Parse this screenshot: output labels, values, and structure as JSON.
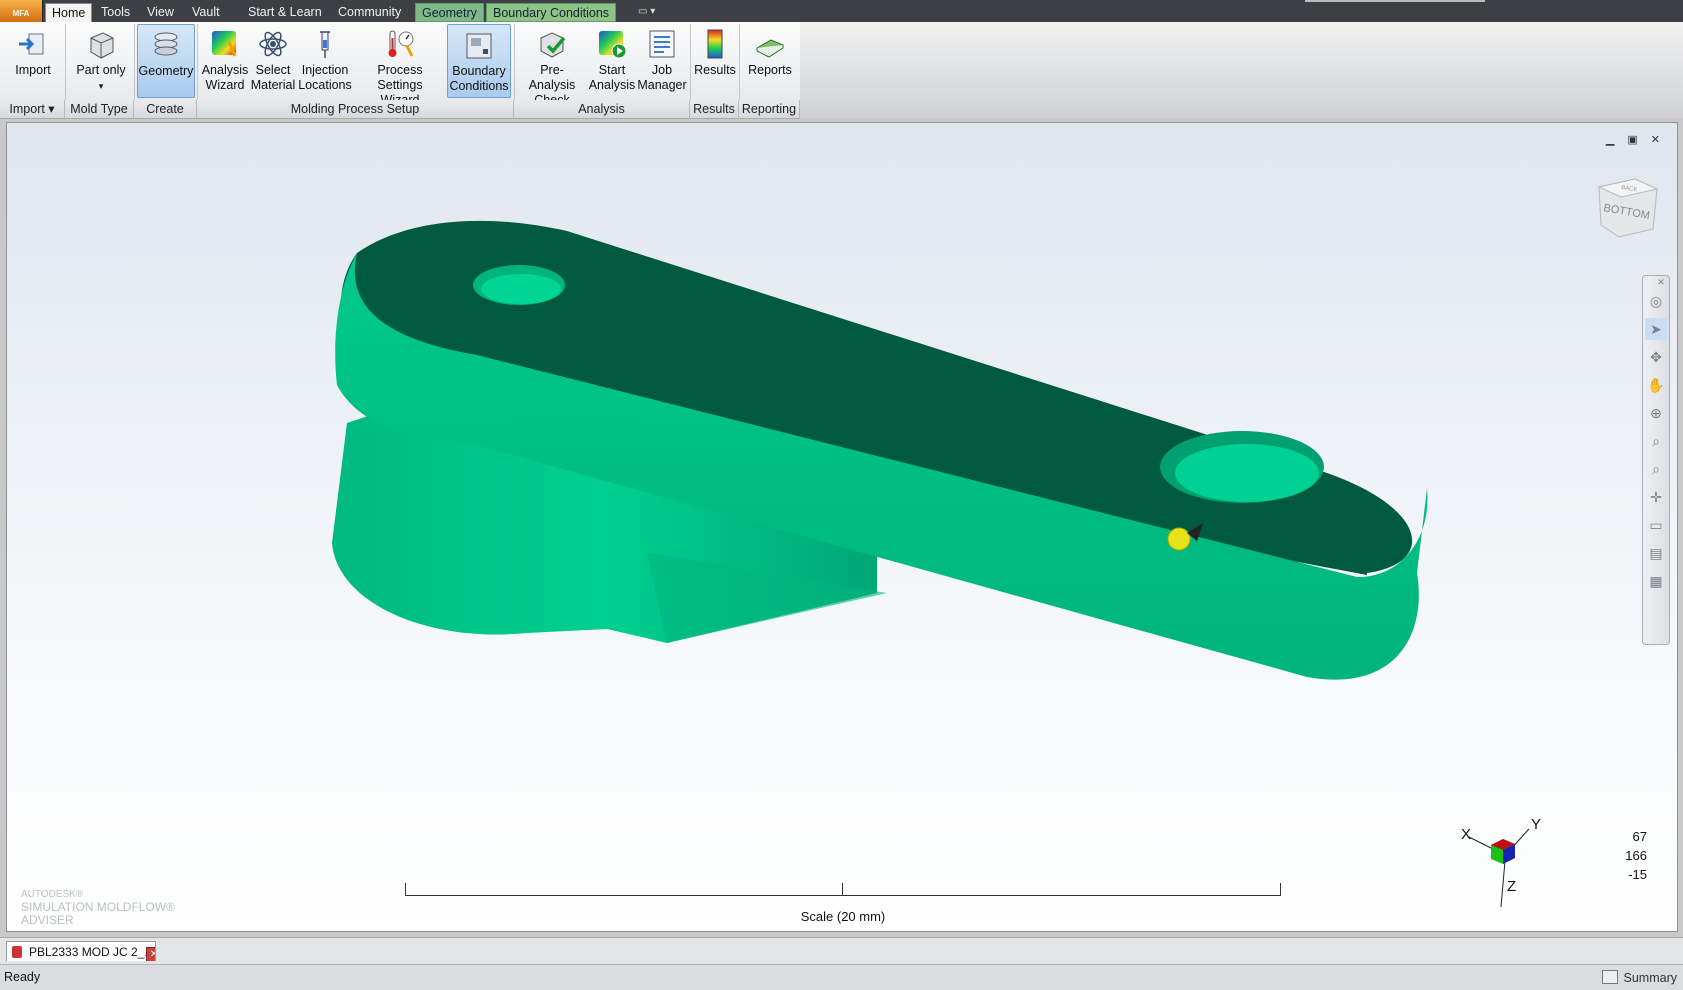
{
  "app": {
    "button_label": "MFA"
  },
  "tabs": [
    "Home",
    "Tools",
    "View",
    "Vault",
    "Start & Learn",
    "Community",
    "Geometry",
    "Boundary Conditions"
  ],
  "ribbon": {
    "buttons": [
      {
        "label": "Import",
        "label2": ""
      },
      {
        "label": "Part only",
        "label2": "▾"
      },
      {
        "label": "Geometry",
        "label2": ""
      },
      {
        "label": "Analysis",
        "label2": "Wizard"
      },
      {
        "label": "Select",
        "label2": "Material"
      },
      {
        "label": "Injection",
        "label2": "Locations"
      },
      {
        "label": "Process Settings",
        "label2": "Wizard"
      },
      {
        "label": "Boundary",
        "label2": "Conditions"
      },
      {
        "label": "Pre-Analysis",
        "label2": "Check"
      },
      {
        "label": "Start",
        "label2": "Analysis"
      },
      {
        "label": "Job",
        "label2": "Manager"
      },
      {
        "label": "Results",
        "label2": ""
      },
      {
        "label": "Reports",
        "label2": ""
      }
    ],
    "groups": [
      "Import ▾",
      "Mold Type",
      "Create",
      "Molding Process Setup",
      "Analysis",
      "Results",
      "Reporting"
    ]
  },
  "viewport": {
    "viewcube_face": "BOTTOM",
    "viewcube_top": "BACK",
    "brand_line1": "AUTODESK®",
    "brand_line2": "SIMULATION MOLDFLOW®",
    "brand_line3": "ADVISER",
    "scale_label": "Scale (20 mm)",
    "coords": [
      "67",
      "166",
      "-15"
    ],
    "axes": {
      "x": "X",
      "y": "Y",
      "z": "Z"
    },
    "part_color": "#00c98a"
  },
  "document_tab": {
    "label": "PBL2333 MOD JC 2_..."
  },
  "status": {
    "text": "Ready",
    "summary": "Summary"
  }
}
